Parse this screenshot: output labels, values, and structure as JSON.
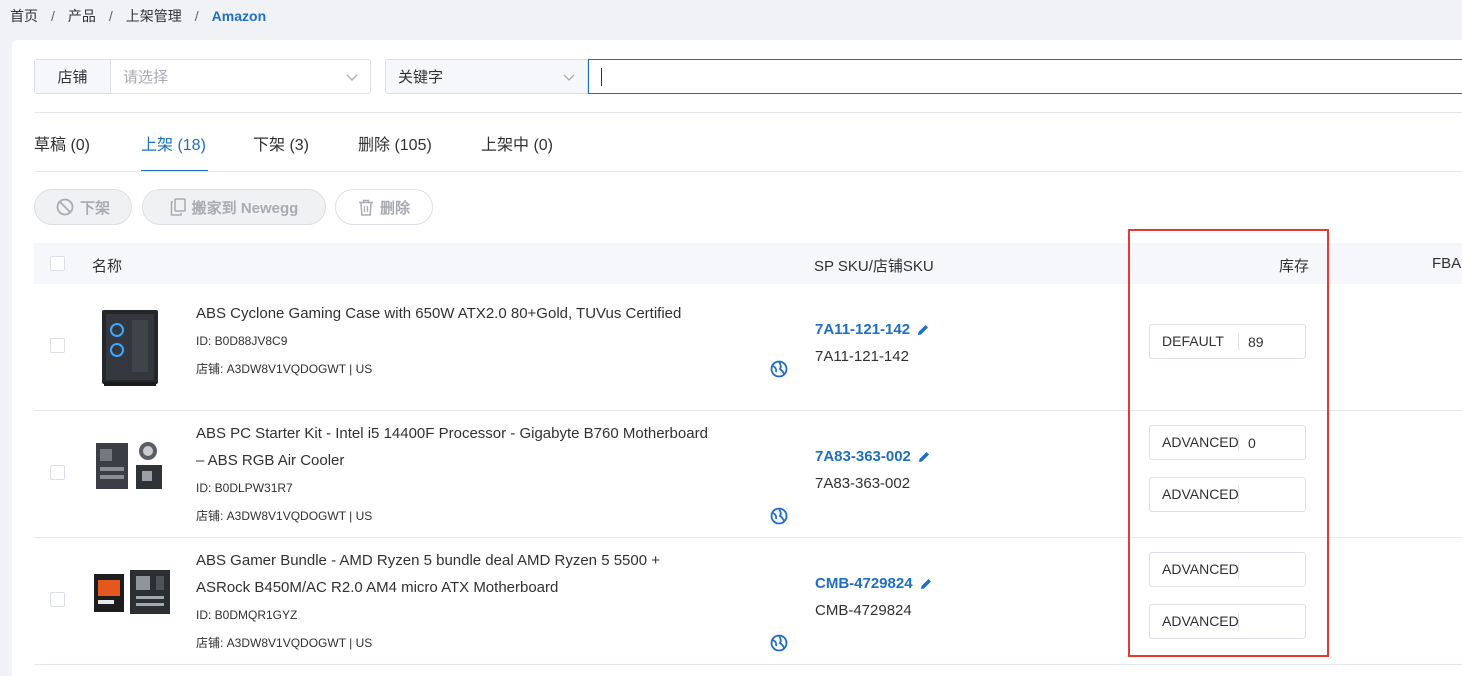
{
  "breadcrumb": {
    "home": "首页",
    "products": "产品",
    "listing": "上架管理",
    "current": "Amazon",
    "sep": "/"
  },
  "filters": {
    "store_label": "店铺",
    "store_placeholder": "请选择",
    "keyword_type": "关键字",
    "keyword_value": ""
  },
  "tabs": [
    {
      "label": "草稿 (0)"
    },
    {
      "label": "上架 (18)",
      "active": true
    },
    {
      "label": "下架 (3)"
    },
    {
      "label": "删除 (105)"
    },
    {
      "label": "上架中 (0)"
    }
  ],
  "actions": {
    "delist": "下架",
    "move": "搬家到 Newegg",
    "delete": "删除"
  },
  "table": {
    "headers": {
      "name": "名称",
      "sku": "SP SKU/店铺SKU",
      "stock": "库存",
      "fba": "FBA"
    },
    "rows": [
      {
        "name": "ABS Cyclone Gaming Case with 650W ATX2.0 80+Gold, TUVus Certified",
        "name_line2": "",
        "id": "ID: B0D88JV8C9",
        "store": "店铺: A3DW8V1VQDOGWT | US",
        "sp_sku": "7A11-121-142",
        "store_sku": "7A11-121-142",
        "stock": [
          {
            "warehouse": "DEFAULT",
            "qty": "89"
          }
        ]
      },
      {
        "name": "ABS PC Starter Kit - Intel i5 14400F Processor - Gigabyte B760 Motherboard",
        "name_line2": "– ABS RGB Air Cooler",
        "id": "ID: B0DLPW31R7",
        "store": "店铺: A3DW8V1VQDOGWT | US",
        "sp_sku": "7A83-363-002",
        "store_sku": "7A83-363-002",
        "stock": [
          {
            "warehouse": "ADVANCED",
            "qty": "0"
          },
          {
            "warehouse": "ADVANCED",
            "qty": ""
          }
        ]
      },
      {
        "name": "ABS Gamer Bundle - AMD Ryzen 5 bundle deal AMD Ryzen 5 5500 +",
        "name_line2": "ASRock B450M/AC R2.0 AM4 micro ATX Motherboard",
        "id": "ID: B0DMQR1GYZ",
        "store": "店铺: A3DW8V1VQDOGWT | US",
        "sp_sku": "CMB-4729824",
        "store_sku": "CMB-4729824",
        "stock": [
          {
            "warehouse": "ADVANCED",
            "qty": ""
          },
          {
            "warehouse": "ADVANCED",
            "qty": ""
          }
        ]
      }
    ]
  },
  "colors": {
    "primary": "#1f6ec6",
    "highlight": "#e53935",
    "border": "#dcdfe6"
  }
}
